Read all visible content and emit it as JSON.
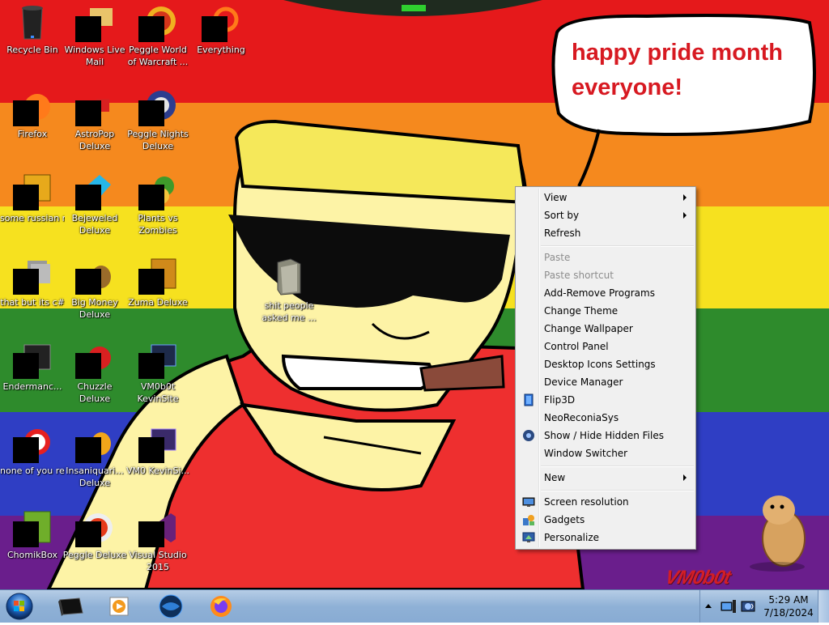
{
  "desktop": {
    "icons": [
      {
        "label": "Recycle Bin",
        "icon": "recycle-bin-icon",
        "redacted": false
      },
      {
        "label": "Windows Live Mail",
        "icon": "mail-icon",
        "redacted": true
      },
      {
        "label": "Peggle World of Warcraft ...",
        "icon": "peggle-wow-icon",
        "redacted": true
      },
      {
        "label": "Everything",
        "icon": "search-icon",
        "redacted": true
      },
      {
        "label": "Firefox",
        "icon": "firefox-icon",
        "redacted": true
      },
      {
        "label": "AstroPop Deluxe",
        "icon": "astropop-icon",
        "redacted": true
      },
      {
        "label": "Peggle Nights Deluxe",
        "icon": "peggle-nights-icon",
        "redacted": true
      },
      {
        "label": "some russian ran a rat",
        "icon": "app-icon",
        "redacted": true
      },
      {
        "label": "Bejeweled Deluxe",
        "icon": "bejeweled-icon",
        "redacted": true
      },
      {
        "label": "Plants vs Zombies",
        "icon": "pvz-icon",
        "redacted": true
      },
      {
        "label": "that but its c#",
        "icon": "app-icon",
        "redacted": true
      },
      {
        "label": "Big Money Deluxe",
        "icon": "big-money-icon",
        "redacted": true
      },
      {
        "label": "Zuma Deluxe",
        "icon": "zuma-icon",
        "redacted": true
      },
      {
        "label": "Endermanc...",
        "icon": "terminal-icon",
        "redacted": true
      },
      {
        "label": "Chuzzle Deluxe",
        "icon": "chuzzle-icon",
        "redacted": true
      },
      {
        "label": "VM0b0t KevinSite",
        "icon": "vm-icon",
        "redacted": true
      },
      {
        "label": "none of you retards kno...",
        "icon": "app-icon",
        "redacted": true
      },
      {
        "label": "Insaniquari... Deluxe",
        "icon": "insaniquarium-icon",
        "redacted": true
      },
      {
        "label": "VM0 KevinSi...",
        "icon": "vm-icon",
        "redacted": true
      },
      {
        "label": "ChomikBox",
        "icon": "chomikbox-icon",
        "redacted": true
      },
      {
        "label": "Peggle Deluxe",
        "icon": "peggle-icon",
        "redacted": true
      },
      {
        "label": "Visual Studio 2015",
        "icon": "visual-studio-icon",
        "redacted": true
      }
    ],
    "folder": {
      "label": "shit people asked me ...",
      "icon": "folder-icon"
    },
    "wallpaper": {
      "speech_bubble": "happy pride month everyone!",
      "watermark": "VM0b0t",
      "stripe_colors": [
        "#e5191b",
        "#f5891e",
        "#f6e11f",
        "#2e8b2c",
        "#2f3ec4",
        "#6a1e8c"
      ]
    }
  },
  "context_menu": {
    "items": [
      {
        "label": "View",
        "submenu": true,
        "disabled": false,
        "icon": null
      },
      {
        "label": "Sort by",
        "submenu": true,
        "disabled": false,
        "icon": null
      },
      {
        "label": "Refresh",
        "submenu": false,
        "disabled": false,
        "icon": null
      },
      {
        "label": "Paste",
        "submenu": false,
        "disabled": true,
        "icon": null
      },
      {
        "label": "Paste shortcut",
        "submenu": false,
        "disabled": true,
        "icon": null
      },
      {
        "label": "Add-Remove Programs",
        "submenu": false,
        "disabled": false,
        "icon": null
      },
      {
        "label": "Change Theme",
        "submenu": false,
        "disabled": false,
        "icon": null
      },
      {
        "label": "Change Wallpaper",
        "submenu": false,
        "disabled": false,
        "icon": null
      },
      {
        "label": "Control Panel",
        "submenu": false,
        "disabled": false,
        "icon": null
      },
      {
        "label": "Desktop Icons Settings",
        "submenu": false,
        "disabled": false,
        "icon": null
      },
      {
        "label": "Device Manager",
        "submenu": false,
        "disabled": false,
        "icon": null
      },
      {
        "label": "Flip3D",
        "submenu": false,
        "disabled": false,
        "icon": "flip3d-icon"
      },
      {
        "label": "NeoReconiaSys",
        "submenu": false,
        "disabled": false,
        "icon": null
      },
      {
        "label": "Show / Hide Hidden Files",
        "submenu": false,
        "disabled": false,
        "icon": "hidden-files-icon"
      },
      {
        "label": "Window Switcher",
        "submenu": false,
        "disabled": false,
        "icon": null
      },
      {
        "label": "New",
        "submenu": true,
        "disabled": false,
        "icon": null
      },
      {
        "label": "Screen resolution",
        "submenu": false,
        "disabled": false,
        "icon": "screen-resolution-icon"
      },
      {
        "label": "Gadgets",
        "submenu": false,
        "disabled": false,
        "icon": "gadgets-icon"
      },
      {
        "label": "Personalize",
        "submenu": false,
        "disabled": false,
        "icon": "personalize-icon"
      }
    ]
  },
  "taskbar": {
    "start_icon": "windows-orb-icon",
    "pinned": [
      {
        "name": "taskbar-app-terminal",
        "icon": "terminal-icon"
      },
      {
        "name": "taskbar-app-media-player",
        "icon": "media-player-icon"
      },
      {
        "name": "taskbar-app-globe",
        "icon": "globe-icon"
      },
      {
        "name": "taskbar-app-firefox",
        "icon": "firefox-icon"
      }
    ],
    "clock": {
      "time": "5:29 AM",
      "date": "7/18/2024"
    }
  }
}
